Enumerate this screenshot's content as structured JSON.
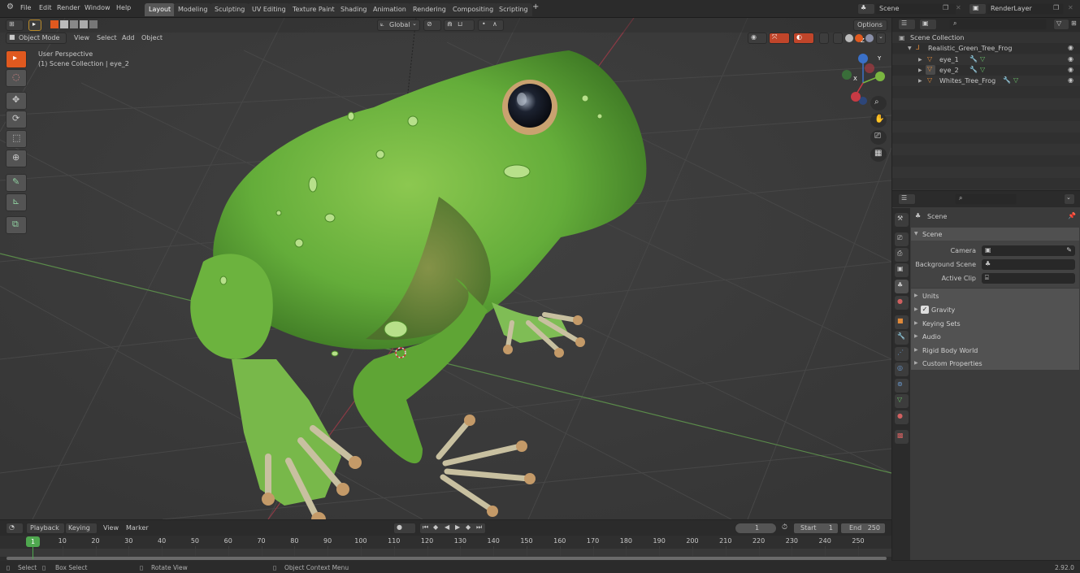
{
  "topbar": {
    "menus": [
      "File",
      "Edit",
      "Render",
      "Window",
      "Help"
    ],
    "workspaces": [
      {
        "label": "Layout",
        "active": true
      },
      {
        "label": "Modeling"
      },
      {
        "label": "Sculpting"
      },
      {
        "label": "UV Editing"
      },
      {
        "label": "Texture Paint"
      },
      {
        "label": "Shading"
      },
      {
        "label": "Animation"
      },
      {
        "label": "Rendering"
      },
      {
        "label": "Compositing"
      },
      {
        "label": "Scripting"
      }
    ],
    "add_workspace": "+",
    "scene": "Scene",
    "render_layer": "RenderLayer"
  },
  "viewport": {
    "mode": "Object Mode",
    "menus": [
      "View",
      "Select",
      "Add",
      "Object"
    ],
    "transform_orientation": "Global",
    "options": "Options",
    "overlay_title": "User Perspective",
    "overlay_subtitle": "(1) Scene Collection | eye_2",
    "gizmo": {
      "x": "X",
      "y": "Y",
      "z": "Z"
    },
    "tools": [
      "select-box",
      "cursor",
      "move",
      "rotate",
      "scale",
      "transform",
      "annotate",
      "measure",
      "add-cube"
    ],
    "nav": [
      "zoom",
      "pan",
      "camera",
      "ortho-grid"
    ],
    "colors": {
      "accent": "#e0591f",
      "grid": "#4a4a4a",
      "x_axis": "#8a3a45",
      "y_axis": "#5e8a3a",
      "frog": "#6cb33e"
    }
  },
  "outliner": {
    "root": "Scene Collection",
    "items": [
      {
        "label": "Realistic_Green_Tree_Frog",
        "type": "empty",
        "level": 1
      },
      {
        "label": "eye_1",
        "type": "mesh",
        "level": 2
      },
      {
        "label": "eye_2",
        "type": "mesh",
        "level": 2,
        "selected": true
      },
      {
        "label": "Whites_Tree_Frog",
        "type": "mesh",
        "level": 2
      }
    ]
  },
  "properties": {
    "context": "Scene",
    "panel": "Scene",
    "fields": [
      {
        "label": "Camera",
        "value": ""
      },
      {
        "label": "Background Scene",
        "value": ""
      },
      {
        "label": "Active Clip",
        "value": ""
      }
    ],
    "subpanels": [
      {
        "label": "Units"
      },
      {
        "label": "Gravity",
        "checkbox": true,
        "checked": true
      },
      {
        "label": "Keying Sets"
      },
      {
        "label": "Audio"
      },
      {
        "label": "Rigid Body World"
      },
      {
        "label": "Custom Properties"
      }
    ]
  },
  "timeline": {
    "menus": [
      "Playback",
      "Keying",
      "View",
      "Marker"
    ],
    "current_frame": "1",
    "start_label": "Start",
    "start": "1",
    "end_label": "End",
    "end": "250",
    "ticks": [
      "10",
      "20",
      "30",
      "40",
      "50",
      "60",
      "70",
      "80",
      "90",
      "100",
      "110",
      "120",
      "130",
      "140",
      "150",
      "160",
      "170",
      "180",
      "190",
      "200",
      "210",
      "220",
      "230",
      "240",
      "250"
    ],
    "playhead": "1"
  },
  "statusbar": {
    "select": "Select",
    "box_select": "Box Select",
    "rotate_view": "Rotate View",
    "context_menu": "Object Context Menu",
    "version": "2.92.0"
  }
}
